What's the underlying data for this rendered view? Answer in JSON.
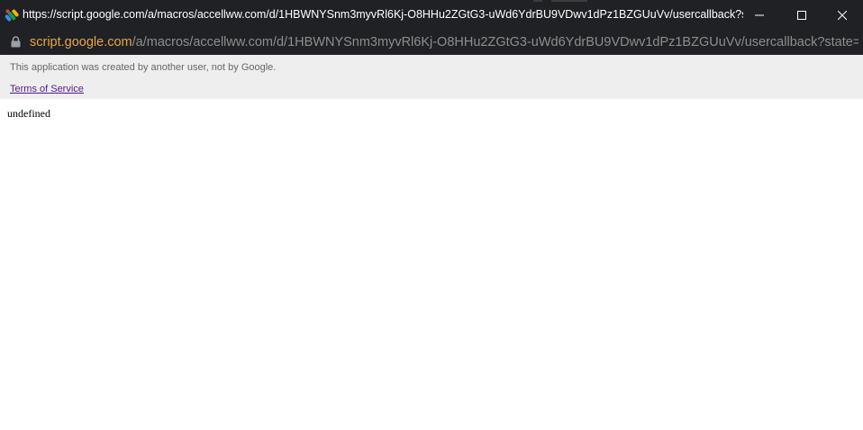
{
  "window": {
    "title": "https://script.google.com/a/macros/accellww.com/d/1HBWNYSnm3myvRl6Kj-O8HHu2ZGtG3-uWd6YdrBU9VDwv1dPz1BZGUuVv/usercallback?state=..."
  },
  "address_bar": {
    "host": "script.google.com",
    "path": "/a/macros/accellww.com/d/1HBWNYSnm3myvRl6Kj-O8HHu2ZGtG3-uWd6YdrBU9VDwv1dPz1BZGUuVv/usercallback?state=ADE..."
  },
  "banner": {
    "notice": "This application was created by another user, not by Google.",
    "terms_link": "Terms of Service"
  },
  "content": {
    "body_text": "undefined"
  },
  "colors": {
    "chrome_bg": "#202124",
    "url_host": "#e8a64a",
    "url_path": "#8e8e8e",
    "banner_bg": "#eeeeee",
    "visited_link": "#551a8b"
  },
  "icons": {
    "app": "apps-script-icon",
    "lock": "lock-icon",
    "minimize": "minimize-icon",
    "maximize": "maximize-icon",
    "close": "close-icon"
  }
}
